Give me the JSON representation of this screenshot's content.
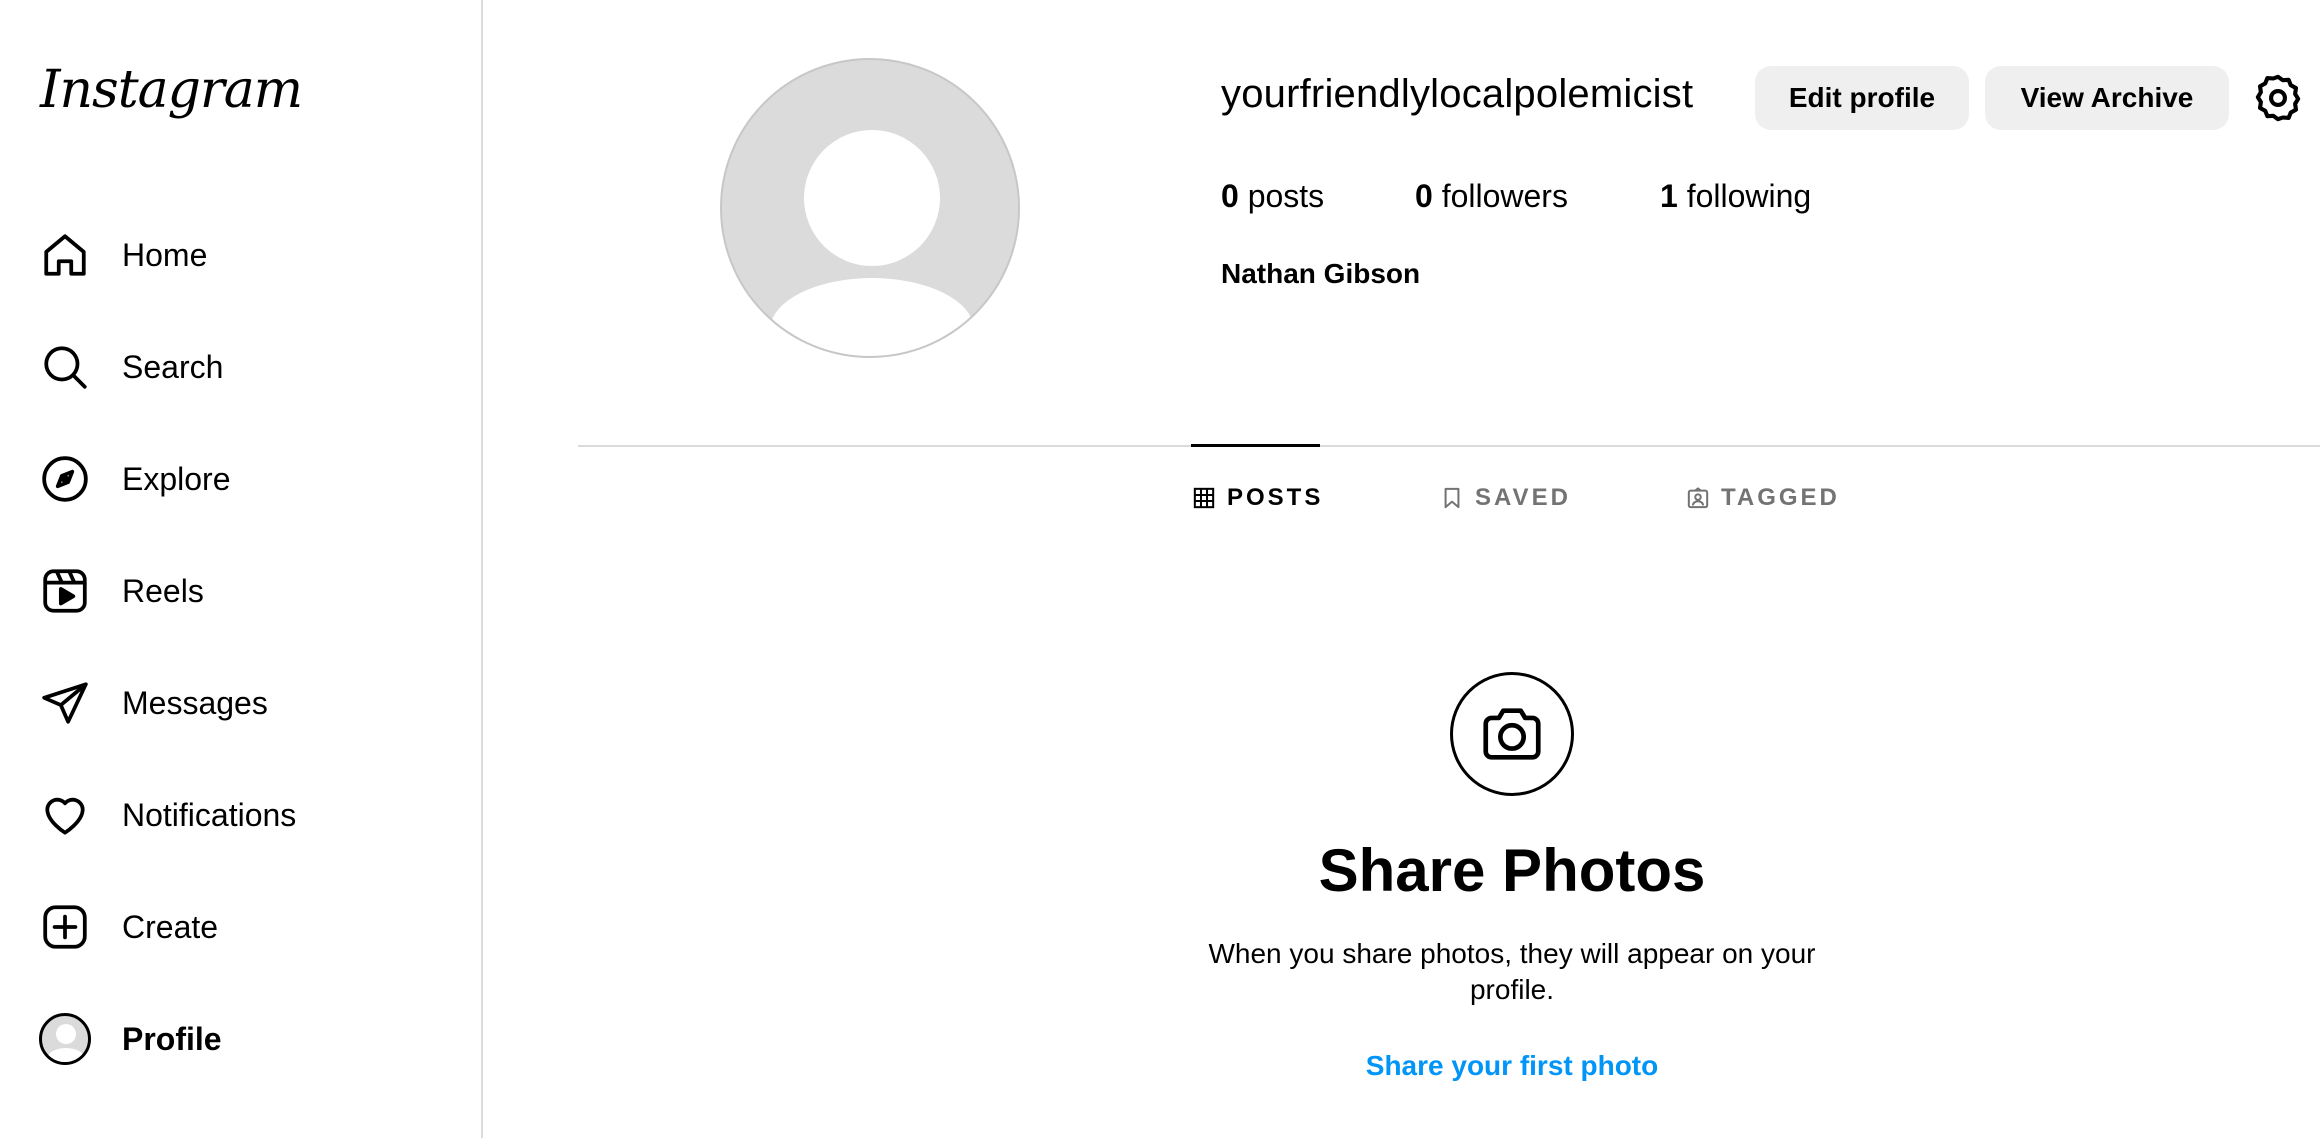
{
  "app": {
    "logo_text": "Instagram"
  },
  "sidebar": {
    "items": [
      {
        "label": "Home",
        "icon": "home-icon"
      },
      {
        "label": "Search",
        "icon": "search-icon"
      },
      {
        "label": "Explore",
        "icon": "compass-icon"
      },
      {
        "label": "Reels",
        "icon": "reels-icon"
      },
      {
        "label": "Messages",
        "icon": "send-icon"
      },
      {
        "label": "Notifications",
        "icon": "heart-icon"
      },
      {
        "label": "Create",
        "icon": "plus-square-icon"
      },
      {
        "label": "Profile",
        "icon": "avatar",
        "active": true
      }
    ]
  },
  "profile": {
    "username": "yourfriendlylocalpolemicist",
    "edit_button": "Edit profile",
    "archive_button": "View Archive",
    "posts_count": "0",
    "posts_label": "posts",
    "followers_count": "0",
    "followers_label": "followers",
    "following_count": "1",
    "following_label": "following",
    "full_name": "Nathan Gibson"
  },
  "tabs": [
    {
      "label": "POSTS",
      "icon": "grid-icon",
      "active": true
    },
    {
      "label": "SAVED",
      "icon": "bookmark-icon",
      "active": false
    },
    {
      "label": "TAGGED",
      "icon": "tagged-icon",
      "active": false
    }
  ],
  "empty_state": {
    "icon": "camera-icon",
    "title": "Share Photos",
    "description": "When you share photos, they will appear on your profile.",
    "link": "Share your first photo"
  },
  "colors": {
    "link": "#0095f6",
    "button_bg": "#efefef",
    "divider": "#dbdbdb",
    "muted_text": "#737373"
  }
}
